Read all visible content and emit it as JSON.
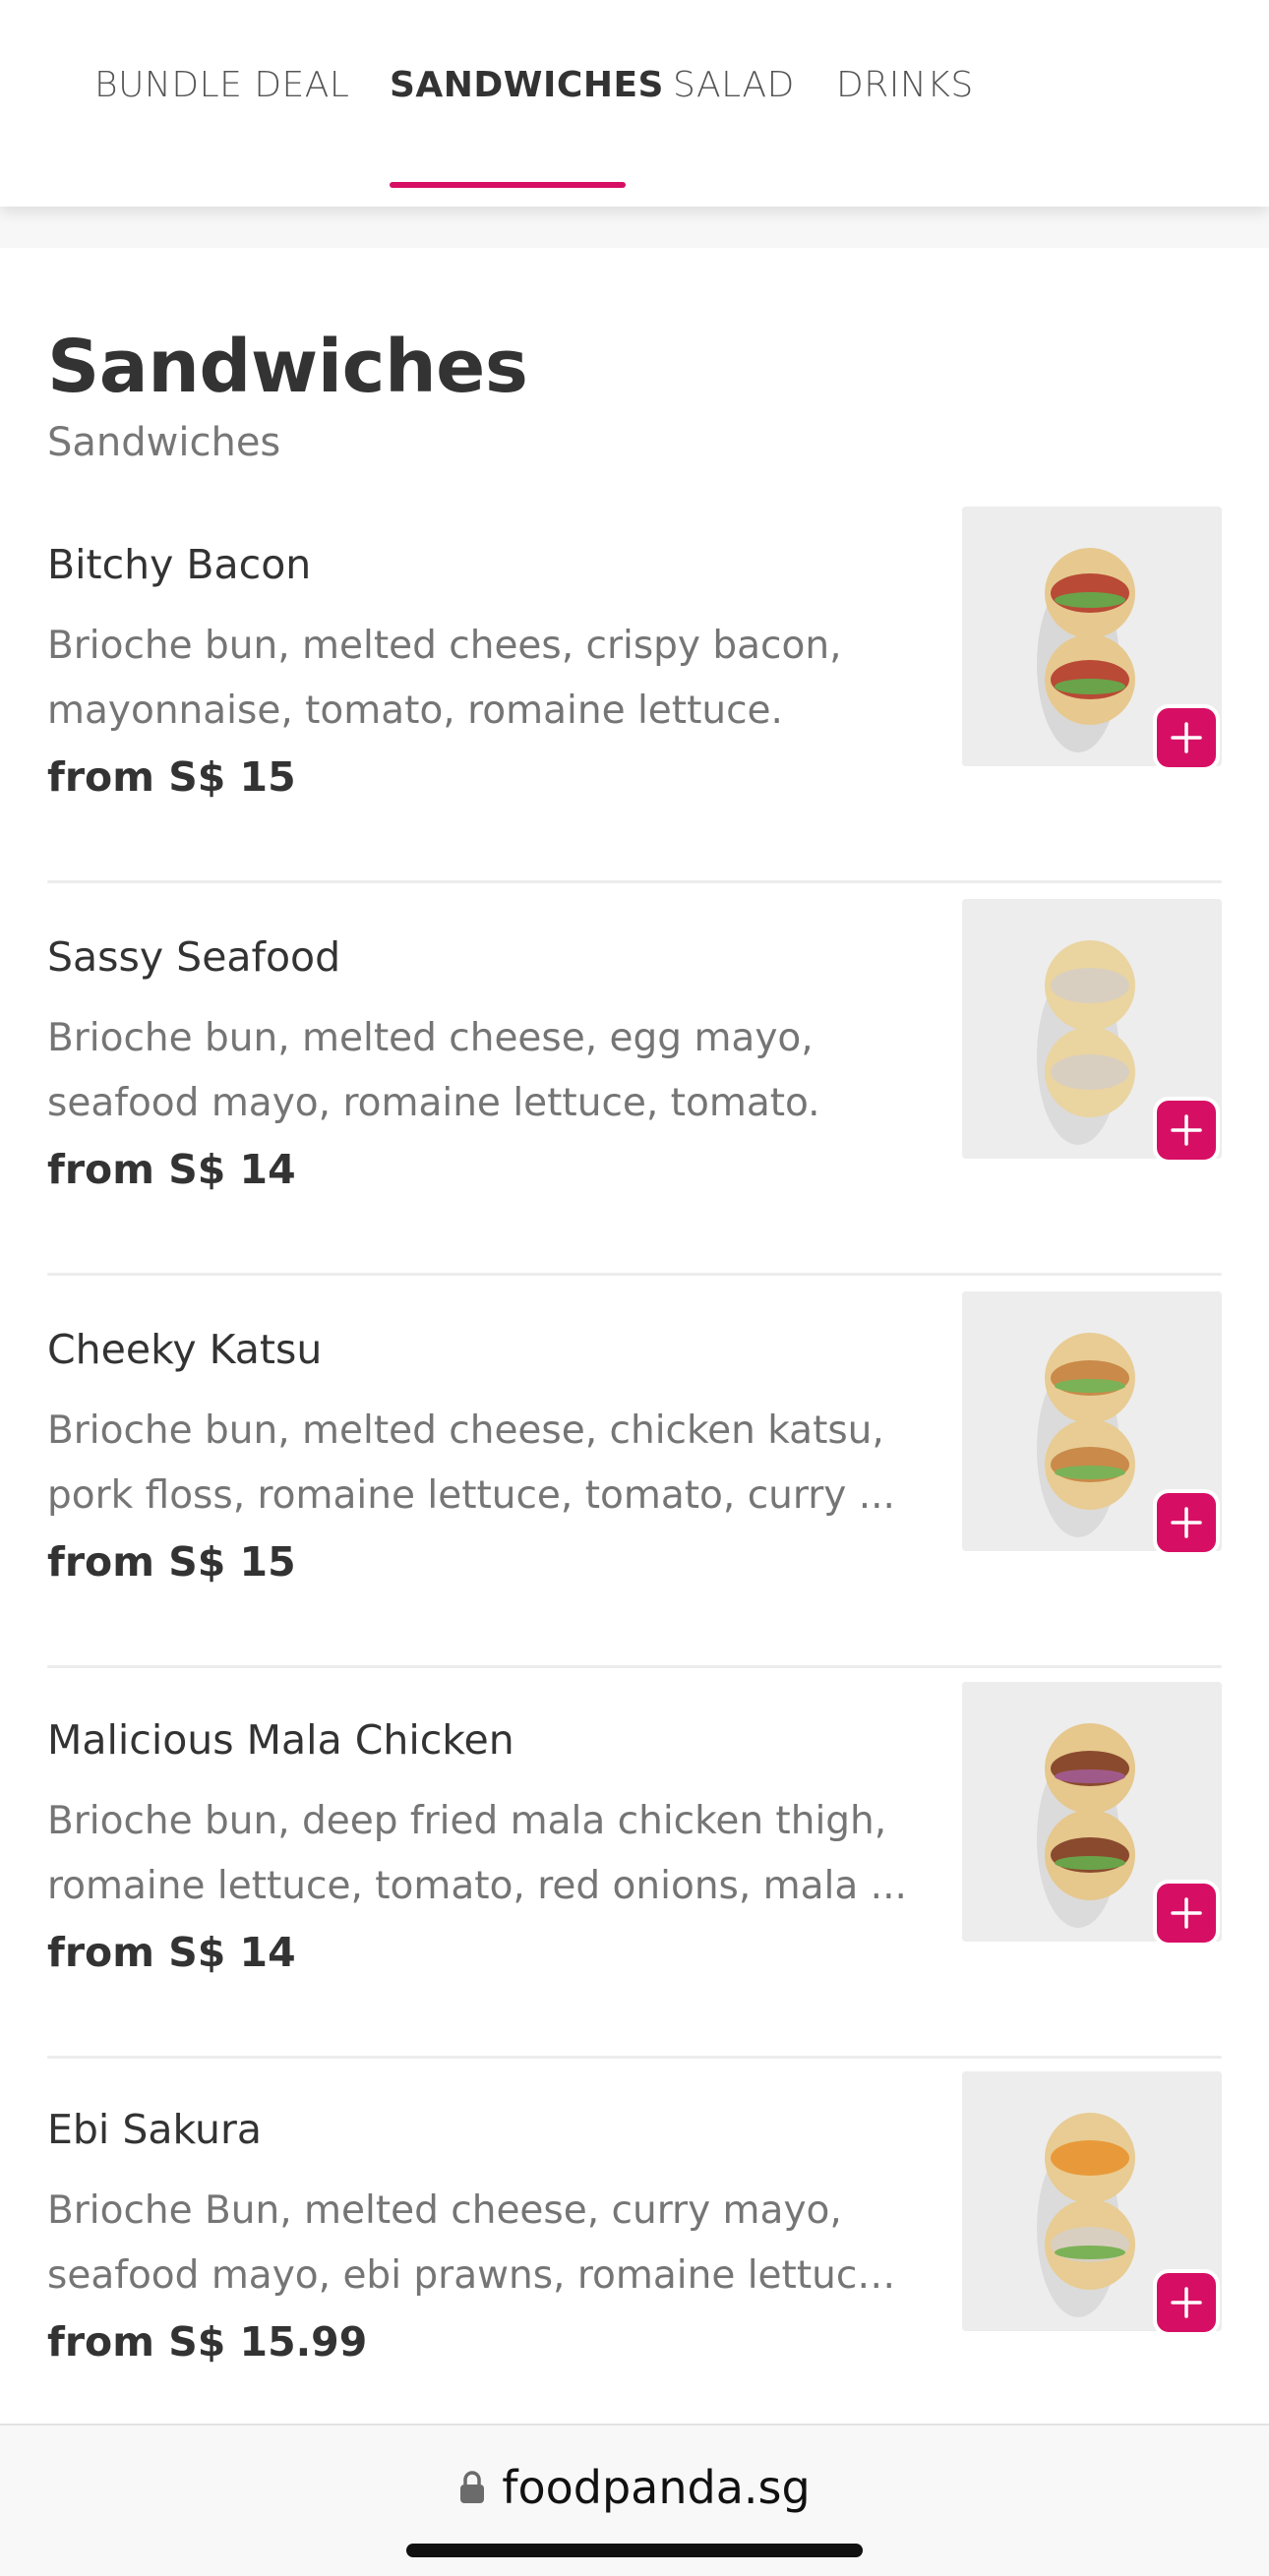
{
  "tabs": [
    {
      "label": "BUNDLE DEAL",
      "active": false
    },
    {
      "label": "SANDWICHES",
      "active": true
    },
    {
      "label": "SALAD",
      "active": false
    },
    {
      "label": "DRINKS",
      "active": false
    }
  ],
  "section": {
    "title": "Sandwiches",
    "subtitle": "Sandwiches"
  },
  "items": [
    {
      "name": "Bitchy Bacon",
      "desc_line1": "Brioche bun, melted chees, crispy bacon,",
      "desc_line2": "mayonnaise, tomato, romaine lettuce.",
      "price": "from S$ 15",
      "add_icon": "plus-icon"
    },
    {
      "name": "Sassy Seafood",
      "desc_line1": "Brioche bun, melted cheese, egg mayo,",
      "desc_line2": "seafood mayo, romaine lettuce, tomato.",
      "price": "from S$ 14",
      "add_icon": "plus-icon"
    },
    {
      "name": "Cheeky Katsu",
      "desc_line1": "Brioche bun, melted cheese, chicken katsu,",
      "desc_line2": "pork floss, romaine lettuce, tomato, curry ...",
      "price": "from S$ 15",
      "add_icon": "plus-icon"
    },
    {
      "name": "Malicious Mala Chicken",
      "desc_line1": "Brioche bun, deep fried mala chicken thigh,",
      "desc_line2": "romaine lettuce, tomato, red onions, mala ...",
      "price": "from S$ 14",
      "add_icon": "plus-icon"
    },
    {
      "name": "Ebi Sakura",
      "desc_line1": "Brioche Bun, melted cheese, curry mayo,",
      "desc_line2": "seafood mayo, ebi prawns, romaine lettuce...",
      "price": "from S$ 15.99",
      "add_icon": "plus-icon"
    }
  ],
  "browser": {
    "url": "foodpanda.sg",
    "lock_icon": "lock-icon"
  },
  "colors": {
    "accent": "#d70f64",
    "text_primary": "#333333",
    "text_secondary": "#757575"
  }
}
